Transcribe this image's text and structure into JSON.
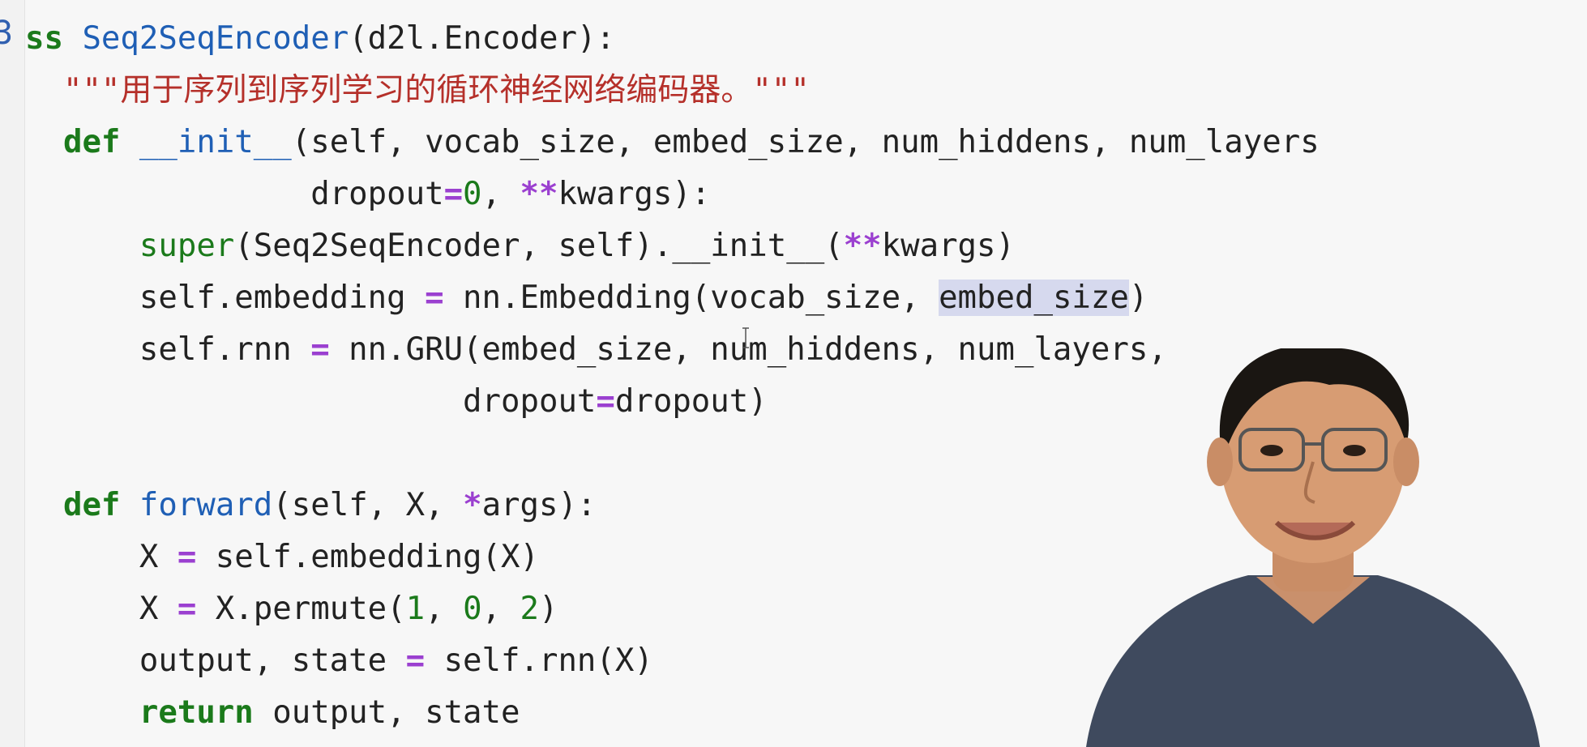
{
  "gutter": {
    "marker": "3"
  },
  "code_lines": [
    [
      {
        "t": "ss ",
        "c": "kw"
      },
      {
        "t": "Seq2SeqEncoder",
        "c": "cls"
      },
      {
        "t": "(d2l.Encoder):",
        "c": ""
      }
    ],
    [
      {
        "t": "  \"\"\"用于序列到序列学习的循环神经网络编码器。\"\"\"",
        "c": "doc"
      }
    ],
    [
      {
        "t": "  ",
        "c": ""
      },
      {
        "t": "def",
        "c": "kw"
      },
      {
        "t": " ",
        "c": ""
      },
      {
        "t": "__init__",
        "c": "fn"
      },
      {
        "t": "(self, vocab_size, embed_size, num_hiddens, num_layers",
        "c": ""
      }
    ],
    [
      {
        "t": "               dropout",
        "c": ""
      },
      {
        "t": "=",
        "c": "op"
      },
      {
        "t": "0",
        "c": "num"
      },
      {
        "t": ", ",
        "c": ""
      },
      {
        "t": "**",
        "c": "op"
      },
      {
        "t": "kwargs):",
        "c": ""
      }
    ],
    [
      {
        "t": "      ",
        "c": ""
      },
      {
        "t": "super",
        "c": "bi"
      },
      {
        "t": "(Seq2SeqEncoder, self).__init__(",
        "c": ""
      },
      {
        "t": "**",
        "c": "op"
      },
      {
        "t": "kwargs)",
        "c": ""
      }
    ],
    [
      {
        "t": "      self.embedding ",
        "c": ""
      },
      {
        "t": "=",
        "c": "op"
      },
      {
        "t": " nn.Embedding(vocab_size, ",
        "c": ""
      },
      {
        "t": "embed_size",
        "c": "hl"
      },
      {
        "t": ")",
        "c": ""
      }
    ],
    [
      {
        "t": "      self.rnn ",
        "c": ""
      },
      {
        "t": "=",
        "c": "op"
      },
      {
        "t": " nn.GRU(embed_size, num_hiddens, num_layers,",
        "c": ""
      }
    ],
    [
      {
        "t": "                       dropout",
        "c": ""
      },
      {
        "t": "=",
        "c": "op"
      },
      {
        "t": "dropout)",
        "c": ""
      }
    ],
    [
      {
        "t": "",
        "c": ""
      }
    ],
    [
      {
        "t": "  ",
        "c": ""
      },
      {
        "t": "def",
        "c": "kw"
      },
      {
        "t": " ",
        "c": ""
      },
      {
        "t": "forward",
        "c": "fn"
      },
      {
        "t": "(self, X, ",
        "c": ""
      },
      {
        "t": "*",
        "c": "op"
      },
      {
        "t": "args):",
        "c": ""
      }
    ],
    [
      {
        "t": "      X ",
        "c": ""
      },
      {
        "t": "=",
        "c": "op"
      },
      {
        "t": " self.embedding(X)",
        "c": ""
      }
    ],
    [
      {
        "t": "      X ",
        "c": ""
      },
      {
        "t": "=",
        "c": "op"
      },
      {
        "t": " X.permute(",
        "c": ""
      },
      {
        "t": "1",
        "c": "num"
      },
      {
        "t": ", ",
        "c": ""
      },
      {
        "t": "0",
        "c": "num"
      },
      {
        "t": ", ",
        "c": ""
      },
      {
        "t": "2",
        "c": "num"
      },
      {
        "t": ")",
        "c": ""
      }
    ],
    [
      {
        "t": "      output, state ",
        "c": ""
      },
      {
        "t": "=",
        "c": "op"
      },
      {
        "t": " self.rnn(X)",
        "c": ""
      }
    ],
    [
      {
        "t": "      ",
        "c": ""
      },
      {
        "t": "return",
        "c": "kw"
      },
      {
        "t": " output, state",
        "c": ""
      }
    ]
  ],
  "colors": {
    "background": "#f7f7f7",
    "keyword": "#1b7a1b",
    "class_name": "#1f5fb5",
    "docstring": "#b5302a",
    "operator": "#9b40d0",
    "highlight": "#d6d9ee"
  },
  "presenter": {
    "icon": "presenter-webcam-overlay"
  }
}
